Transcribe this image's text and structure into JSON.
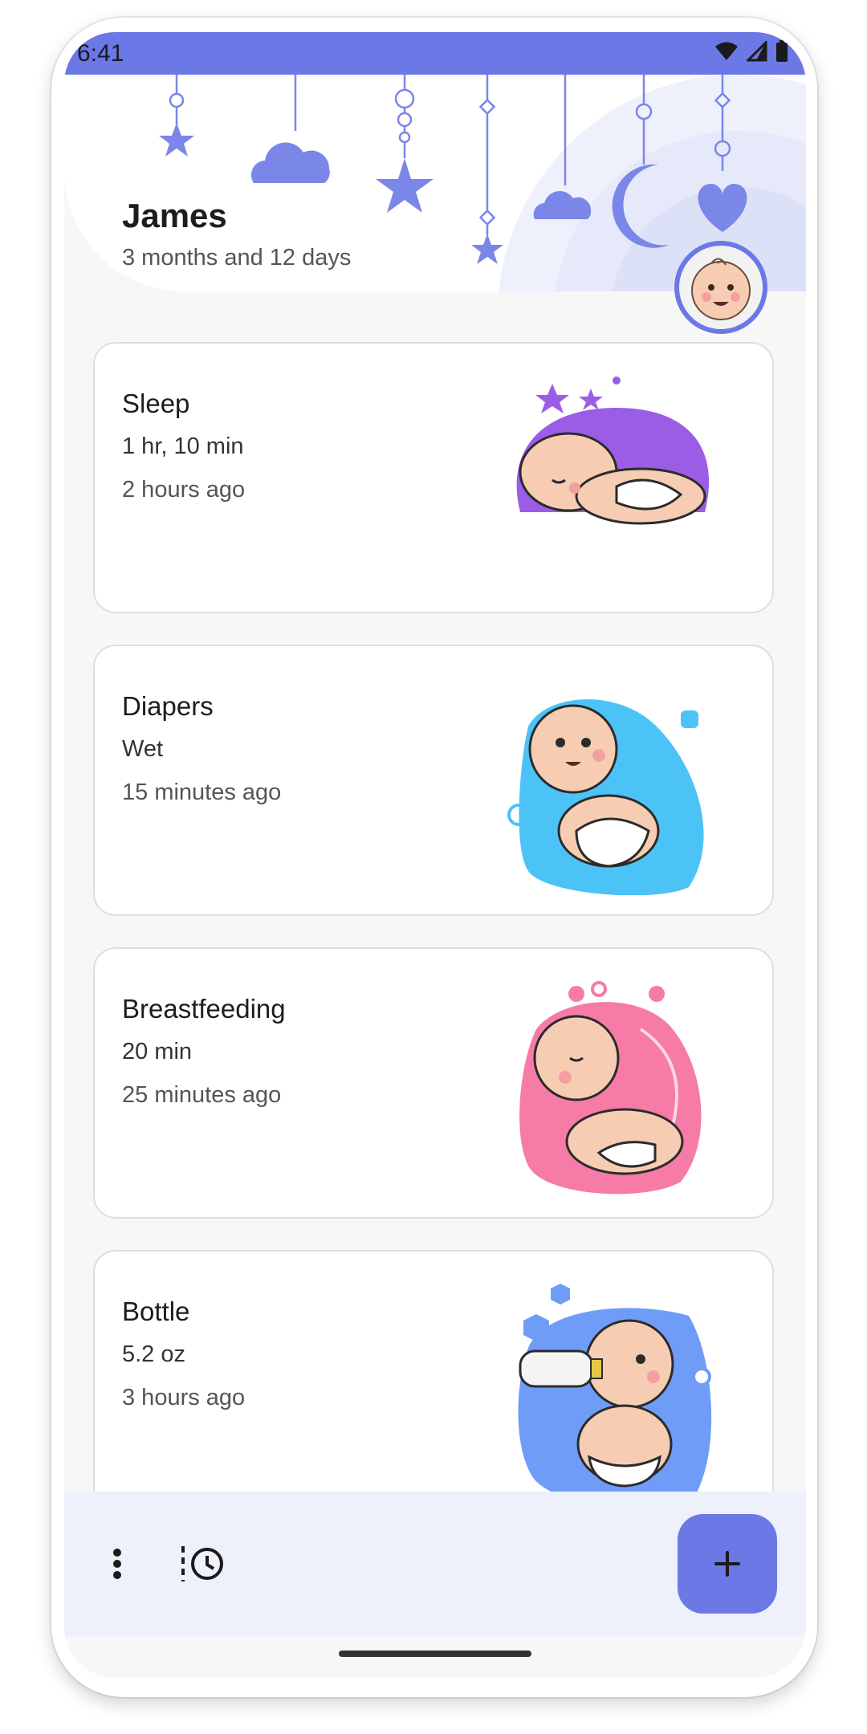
{
  "status": {
    "time": "6:41"
  },
  "profile": {
    "name": "James",
    "age": "3 months and 12 days",
    "avatar_icon": "baby-face-icon"
  },
  "activities": [
    {
      "title": "Sleep",
      "detail": "1 hr, 10 min",
      "time": "2 hours ago",
      "color": "#9b5de5",
      "icon": "sleeping-baby-icon"
    },
    {
      "title": "Diapers",
      "detail": "Wet",
      "time": "15 minutes ago",
      "color": "#4cc3f7",
      "icon": "diaper-baby-icon"
    },
    {
      "title": "Breastfeeding",
      "detail": "20 min",
      "time": "25 minutes ago",
      "color": "#f67ba7",
      "icon": "breastfeeding-baby-icon"
    },
    {
      "title": "Bottle",
      "detail": "5.2 oz",
      "time": "3 hours ago",
      "color": "#6f9cf7",
      "icon": "bottle-baby-icon"
    }
  ],
  "theme": {
    "accent": "#6b78e6",
    "header_bg": "#ffffff",
    "bottom_bar_bg": "#eef0fb"
  },
  "bottom_bar": {
    "menu_icon": "more-vert-icon",
    "history_icon": "history-icon",
    "fab_icon": "plus-icon"
  }
}
